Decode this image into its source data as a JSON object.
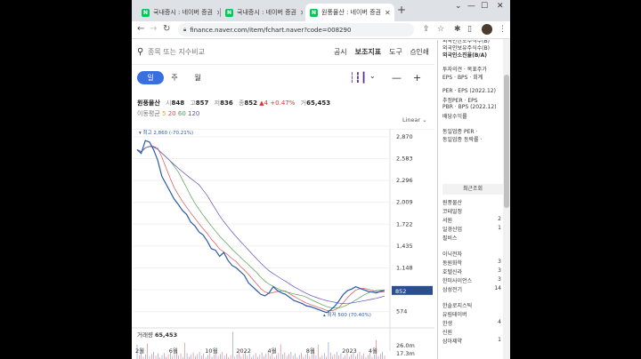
{
  "tabs": [
    {
      "label": "국내증시 : 네이버 증권",
      "active": false
    },
    {
      "label": "국내증시 : 네이버 증권",
      "active": false
    },
    {
      "label": "원풍물산 : 네이버 증권",
      "active": true
    }
  ],
  "url": "finance.naver.com/item/fchart.naver?code=008290",
  "search": {
    "placeholder": "종목 또는 지수비교"
  },
  "toplinks": [
    "공시",
    "보조지표",
    "도구",
    "인쇄"
  ],
  "periods": [
    "일",
    "주",
    "월"
  ],
  "stock": {
    "name": "원풍물산",
    "open_label": "시",
    "open": "848",
    "high_label": "고",
    "high": "857",
    "low_label": "저",
    "low": "836",
    "close_label": "종",
    "close": "852",
    "change": "▲4 +0.47%",
    "volume_label": "거",
    "volume": "65,453"
  },
  "ma": {
    "label": "이동평균",
    "periods": [
      "5",
      "20",
      "60",
      "120"
    ]
  },
  "scale": "Linear",
  "chart_data": {
    "type": "line",
    "title": "",
    "x_ticks": [
      "2월",
      "6월",
      "10월",
      "2022",
      "4월",
      "8월",
      "2023",
      "4월"
    ],
    "y_ticks": [
      2870,
      2583,
      2296,
      2009,
      1722,
      1435,
      1148,
      861,
      574
    ],
    "ylim": [
      500,
      2950
    ],
    "series": [
      {
        "values": [
          2700,
          2650,
          2820,
          2800,
          2700,
          2560,
          2350,
          2250,
          2150,
          2050,
          1980,
          1900,
          1850,
          1750,
          1700,
          1620,
          1580,
          1500,
          1400,
          1380,
          1300,
          1350,
          1250,
          1180,
          1150,
          1100,
          1050,
          950,
          900,
          850,
          800,
          780,
          820,
          900,
          850,
          820,
          800,
          760,
          720,
          700,
          680,
          650,
          640,
          620,
          600,
          580,
          560,
          600,
          650,
          720,
          800,
          850,
          870,
          900,
          880,
          860,
          840,
          830,
          820,
          840,
          852
        ]
      }
    ],
    "high_annotation": "최고 2,860 (-70.21%)",
    "low_annotation": "최저 500 (70.40%)",
    "current_price_label": "852",
    "volume": {
      "label": "거래량",
      "value": "65,453",
      "y_ticks": [
        "26.0m",
        "17.3m",
        "8.67m"
      ]
    }
  },
  "sidebar": {
    "items_top": [
      "외국인한도주식수(B)",
      "외국인보유주식수(B)",
      "외국인소진율(B/A)"
    ],
    "items_mid": [
      "투자의견 · 목표주가",
      "EPS · BPS · 회계"
    ],
    "items_per": [
      "PER · EPS (2022.12)",
      "추정PER · EPS",
      "PBR · BPS (2022.12)",
      "배당수익률"
    ],
    "items_industry": [
      "동일업종 PER ·",
      "동일업종 등락률 ·"
    ],
    "recent_title": "최근조회",
    "recent": [
      {
        "name": "원풍물산",
        "num": ""
      },
      {
        "name": "코테일정",
        "num": ""
      },
      {
        "name": "서원",
        "num": "2"
      },
      {
        "name": "일경산업",
        "num": "1"
      },
      {
        "name": "필비스",
        "num": ""
      },
      {
        "name": "이닉전자",
        "num": ""
      },
      {
        "name": "동원화학",
        "num": "3"
      },
      {
        "name": "호텔신라",
        "num": "3"
      },
      {
        "name": "한미사이언스",
        "num": "3"
      },
      {
        "name": "삼성전기",
        "num": "14"
      },
      {
        "name": "한솔로지스틱",
        "num": ""
      },
      {
        "name": "유림테이버",
        "num": ""
      },
      {
        "name": "한생",
        "num": "4"
      },
      {
        "name": "신원",
        "num": ""
      },
      {
        "name": "삼아제약",
        "num": "1"
      }
    ]
  }
}
